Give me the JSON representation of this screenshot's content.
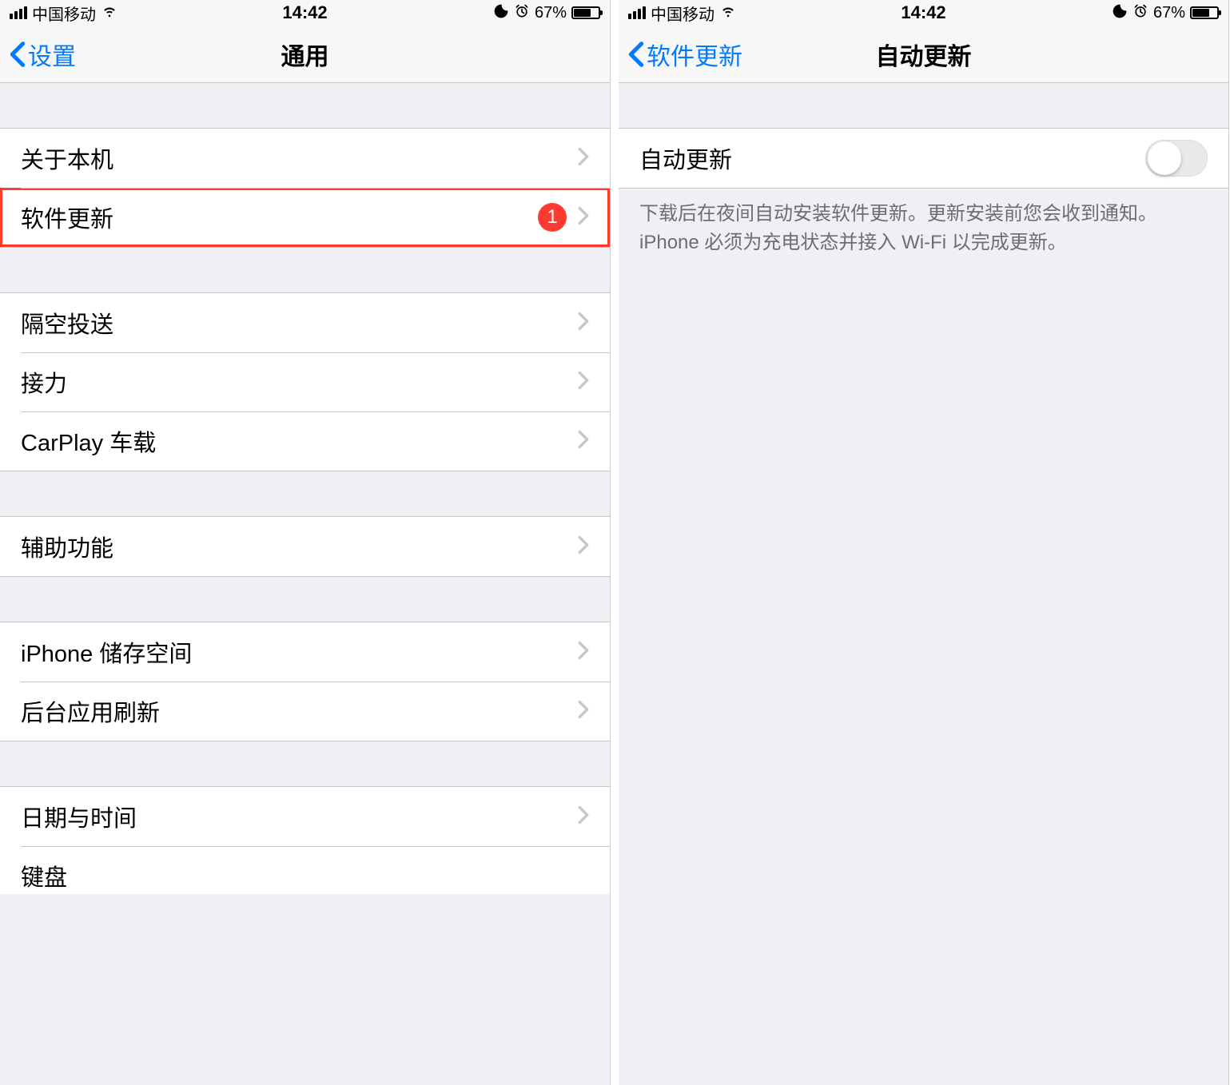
{
  "status": {
    "carrier": "中国移动",
    "time": "14:42",
    "battery_pct": "67%"
  },
  "left": {
    "nav_back": "设置",
    "nav_title": "通用",
    "groups": [
      [
        {
          "label": "关于本机",
          "badge": null,
          "highlight": false
        },
        {
          "label": "软件更新",
          "badge": "1",
          "highlight": true
        }
      ],
      [
        {
          "label": "隔空投送"
        },
        {
          "label": "接力"
        },
        {
          "label": "CarPlay 车载"
        }
      ],
      [
        {
          "label": "辅助功能"
        }
      ],
      [
        {
          "label": "iPhone 储存空间"
        },
        {
          "label": "后台应用刷新"
        }
      ],
      [
        {
          "label": "日期与时间"
        },
        {
          "label": "键盘"
        }
      ]
    ]
  },
  "right": {
    "nav_back": "软件更新",
    "nav_title": "自动更新",
    "toggle_label": "自动更新",
    "toggle_on": false,
    "footer": "下载后在夜间自动安装软件更新。更新安装前您会收到通知。iPhone 必须为充电状态并接入 Wi-Fi 以完成更新。"
  }
}
